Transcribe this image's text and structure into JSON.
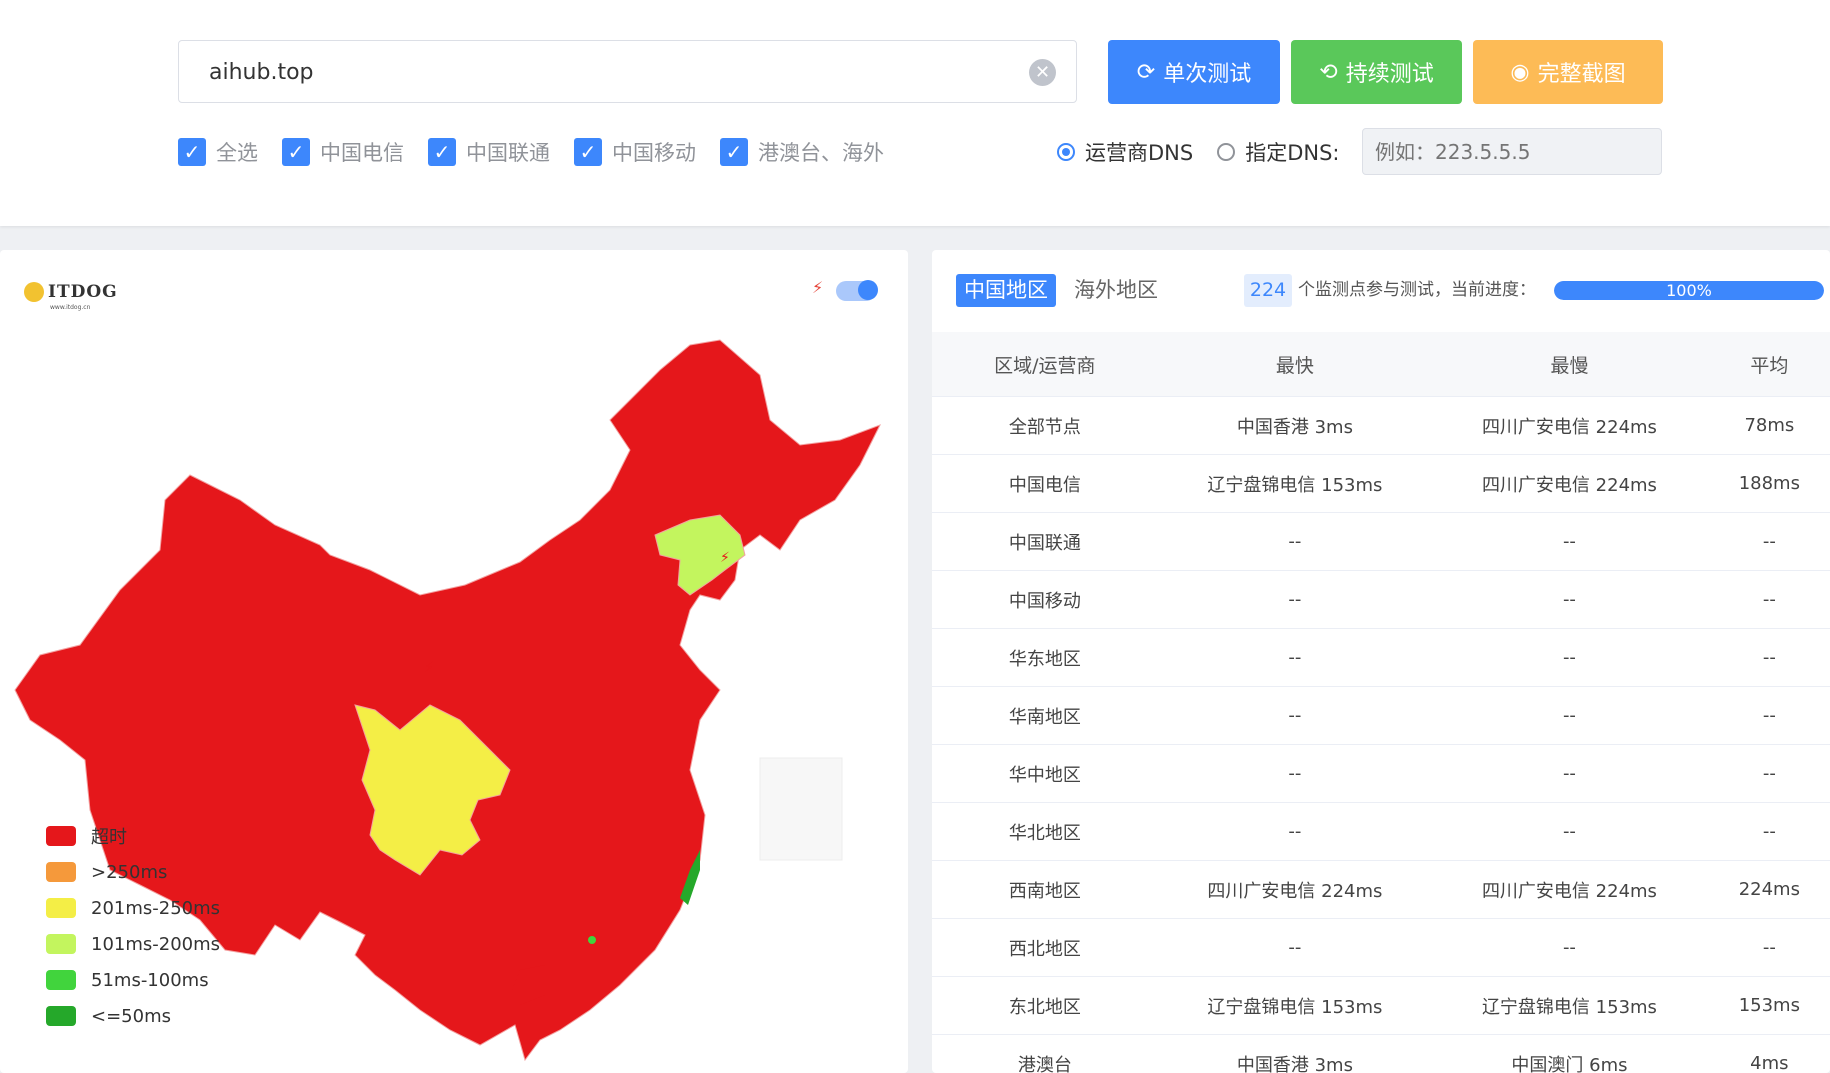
{
  "search": {
    "value": "aihub.top"
  },
  "buttons": {
    "single": "单次测试",
    "continuous": "持续测试",
    "screenshot": "完整截图"
  },
  "isp_filters": [
    {
      "label": "全选",
      "checked": true
    },
    {
      "label": "中国电信",
      "checked": true
    },
    {
      "label": "中国联通",
      "checked": true
    },
    {
      "label": "中国移动",
      "checked": true
    },
    {
      "label": "港澳台、海外",
      "checked": true
    }
  ],
  "dns": {
    "isp_label": "运营商DNS",
    "custom_label": "指定DNS:",
    "placeholder": "例如：223.5.5.5"
  },
  "map": {
    "logo_text": "ITDOG",
    "logo_sub": "www.itdog.cn",
    "legend": [
      {
        "label": "超时",
        "color": "#e5171b"
      },
      {
        "label": ">250ms",
        "color": "#f5993b"
      },
      {
        "label": "201ms-250ms",
        "color": "#f4ee46"
      },
      {
        "label": "101ms-200ms",
        "color": "#c3f55e"
      },
      {
        "label": "51ms-100ms",
        "color": "#41d43d"
      },
      {
        "label": "<=50ms",
        "color": "#25a82a"
      }
    ]
  },
  "panel": {
    "tab_cn": "中国地区",
    "tab_overseas": "海外地区",
    "node_count": "224",
    "count_text": "个监测点参与测试，当前进度：",
    "progress_label": "100%",
    "progress_value": 100
  },
  "table": {
    "headers": [
      "区域/运营商",
      "最快",
      "最慢",
      "平均"
    ],
    "rows": [
      [
        "全部节点",
        "中国香港 3ms",
        "四川广安电信 224ms",
        "78ms"
      ],
      [
        "中国电信",
        "辽宁盘锦电信 153ms",
        "四川广安电信 224ms",
        "188ms"
      ],
      [
        "中国联通",
        "--",
        "--",
        "--"
      ],
      [
        "中国移动",
        "--",
        "--",
        "--"
      ],
      [
        "华东地区",
        "--",
        "--",
        "--"
      ],
      [
        "华南地区",
        "--",
        "--",
        "--"
      ],
      [
        "华中地区",
        "--",
        "--",
        "--"
      ],
      [
        "华北地区",
        "--",
        "--",
        "--"
      ],
      [
        "西南地区",
        "四川广安电信 224ms",
        "四川广安电信 224ms",
        "224ms"
      ],
      [
        "西北地区",
        "--",
        "--",
        "--"
      ],
      [
        "东北地区",
        "辽宁盘锦电信 153ms",
        "辽宁盘锦电信 153ms",
        "153ms"
      ],
      [
        "港澳台",
        "中国香港 3ms",
        "中国澳门 6ms",
        "4ms"
      ]
    ]
  }
}
